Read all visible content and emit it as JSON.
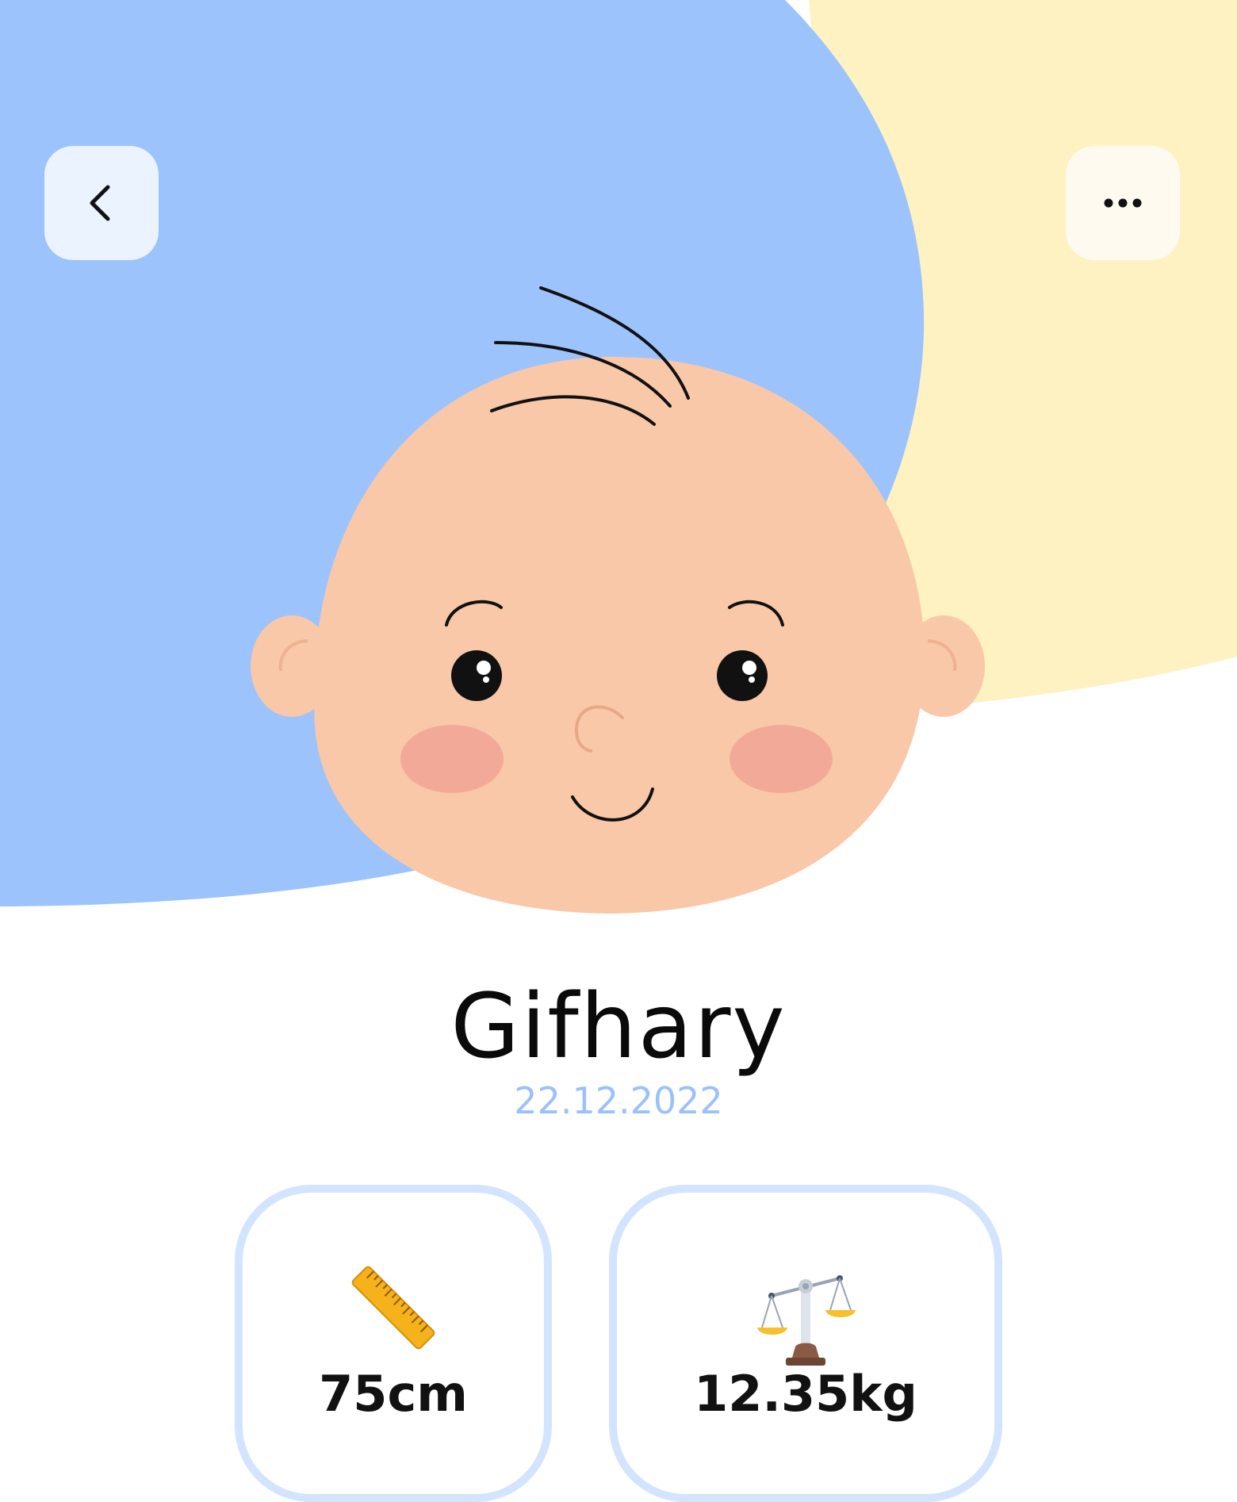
{
  "header": {
    "back_icon": "chevron-left-icon",
    "more_icon": "more-horizontal-icon"
  },
  "colors": {
    "blue_blob": "#9dc3fc",
    "yellow_blob": "#fef2c3",
    "skin": "#f8c8a8",
    "date": "#9bc1fc",
    "card_border": "#d3e4fe"
  },
  "profile": {
    "name": "Gifhary",
    "birth_date": "22.12.2022"
  },
  "stats": [
    {
      "icon": "ruler-icon",
      "value": "75cm"
    },
    {
      "icon": "scale-icon",
      "value": "12.35kg"
    }
  ]
}
